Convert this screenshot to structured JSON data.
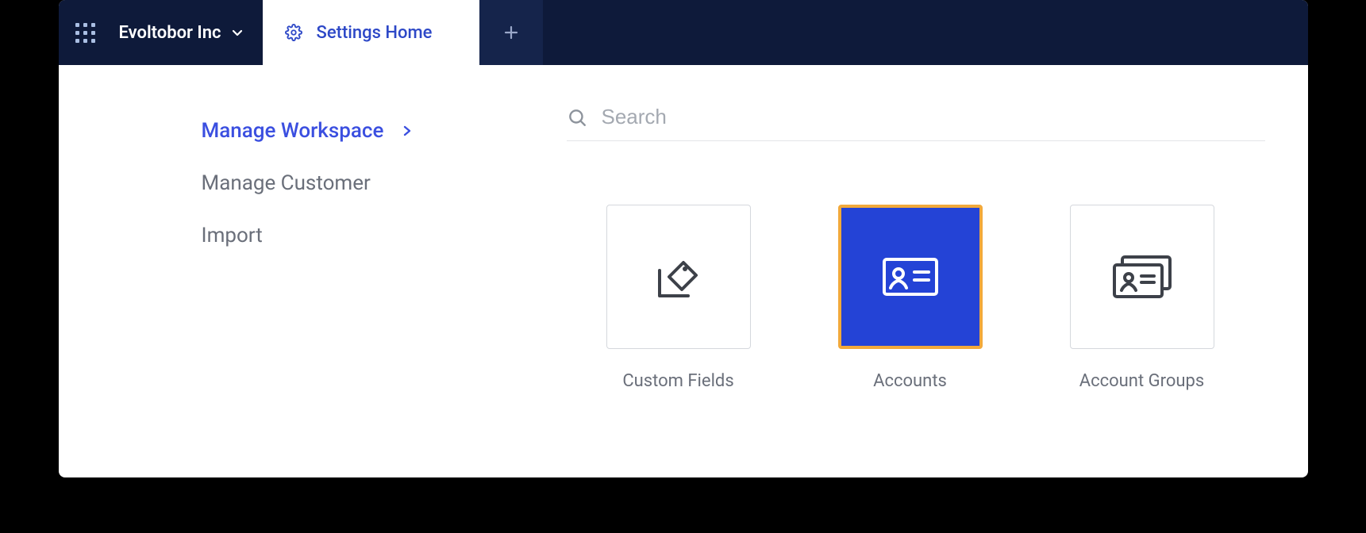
{
  "header": {
    "org_name": "Evoltobor Inc",
    "tab_label": "Settings Home"
  },
  "sidebar": {
    "items": [
      {
        "label": "Manage Workspace",
        "active": true
      },
      {
        "label": "Manage Customer",
        "active": false
      },
      {
        "label": "Import",
        "active": false
      }
    ]
  },
  "search": {
    "placeholder": "Search",
    "value": ""
  },
  "tiles": [
    {
      "label": "Custom Fields",
      "icon": "tag-icon",
      "selected": false
    },
    {
      "label": "Accounts",
      "icon": "id-card-icon",
      "selected": true
    },
    {
      "label": "Account Groups",
      "icon": "id-cards-icon",
      "selected": false
    }
  ]
}
